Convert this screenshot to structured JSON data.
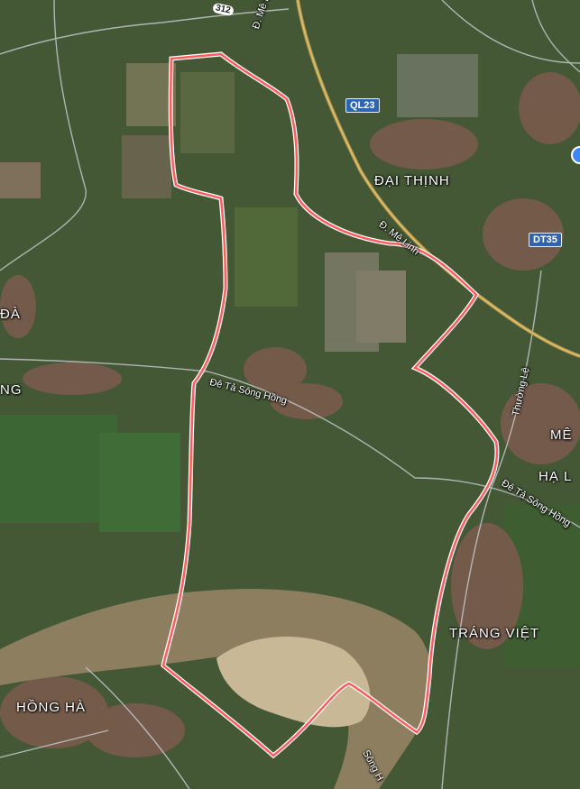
{
  "map": {
    "place_labels": [
      {
        "id": "dai-thinh",
        "text": "ĐẠI THỊNH"
      },
      {
        "id": "trang-viet",
        "text": "TRÁNG VIỆT"
      },
      {
        "id": "hong-ha",
        "text": "HỒNG HÀ"
      },
      {
        "id": "me",
        "text": "MÊ"
      },
      {
        "id": "ha-l",
        "text": "HẠ L"
      },
      {
        "id": "da",
        "text": "ĐÀ"
      },
      {
        "id": "ng",
        "text": "NG"
      }
    ],
    "road_labels": [
      {
        "id": "d-me-linh-north",
        "text": "Đ. Mê Linh"
      },
      {
        "id": "d-me-linh-south",
        "text": "Đ. Mê Linh"
      },
      {
        "id": "de-ta-song-hong-west",
        "text": "Đê Tả Sông Hồng"
      },
      {
        "id": "de-ta-song-hong-east",
        "text": "Đê Tả Sông Hồng"
      },
      {
        "id": "thuong-le",
        "text": "Thường Lệ"
      },
      {
        "id": "song-hong",
        "text": "Sông H"
      }
    ],
    "shields": [
      {
        "id": "ql23",
        "text": "QL23"
      },
      {
        "id": "dt35",
        "text": "DT35"
      },
      {
        "id": "road-312",
        "text": "312"
      }
    ],
    "colors": {
      "boundary": "#ff5b5b",
      "highway": "#c7a24a",
      "shield": "#2f63b3",
      "river": "#8a7a5c",
      "field": "#4f6a35",
      "urban": "#7d5a4b"
    }
  }
}
